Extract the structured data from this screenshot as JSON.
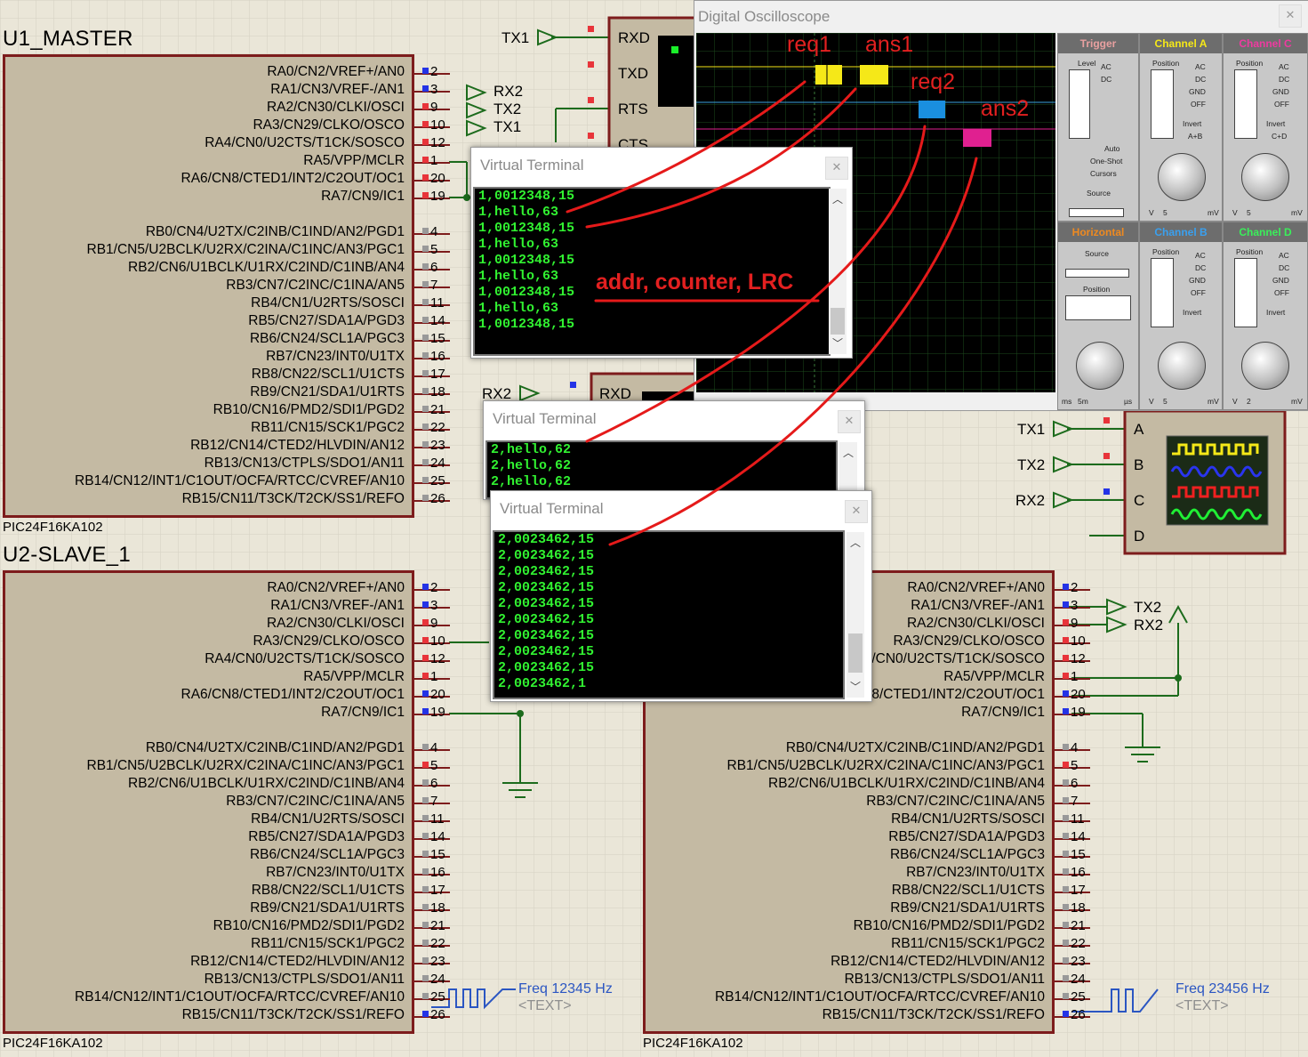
{
  "chips": {
    "master": {
      "title": "U1_MASTER",
      "part": "PIC24F16KA102"
    },
    "slave1": {
      "title": "U2-SLAVE_1",
      "part": "PIC24F16KA102"
    },
    "slave2": {
      "part": "PIC24F16KA102"
    }
  },
  "pins_ra": [
    {
      "label": "RA0/CN2/VREF+/AN0",
      "num": "2"
    },
    {
      "label": "RA1/CN3/VREF-/AN1",
      "num": "3"
    },
    {
      "label": "RA2/CN30/CLKI/OSCI",
      "num": "9"
    },
    {
      "label": "RA3/CN29/CLKO/OSCO",
      "num": "10"
    },
    {
      "label": "RA4/CN0/U2CTS/T1CK/SOSCO",
      "num": "12"
    },
    {
      "label": "RA5/VPP/MCLR",
      "num": "1"
    },
    {
      "label": "RA6/CN8/CTED1/INT2/C2OUT/OC1",
      "num": "20"
    },
    {
      "label": "RA7/CN9/IC1",
      "num": "19"
    }
  ],
  "pins_rb": [
    {
      "label": "RB0/CN4/U2TX/C2INB/C1IND/AN2/PGD1",
      "num": "4"
    },
    {
      "label": "RB1/CN5/U2BCLK/U2RX/C2INA/C1INC/AN3/PGC1",
      "num": "5"
    },
    {
      "label": "RB2/CN6/U1BCLK/U1RX/C2IND/C1INB/AN4",
      "num": "6"
    },
    {
      "label": "RB3/CN7/C2INC/C1INA/AN5",
      "num": "7"
    },
    {
      "label": "RB4/CN1/U2RTS/SOSCI",
      "num": "11"
    },
    {
      "label": "RB5/CN27/SDA1A/PGD3",
      "num": "14"
    },
    {
      "label": "RB6/CN24/SCL1A/PGC3",
      "num": "15"
    },
    {
      "label": "RB7/CN23/INT0/U1TX",
      "num": "16"
    },
    {
      "label": "RB8/CN22/SCL1/U1CTS",
      "num": "17"
    },
    {
      "label": "RB9/CN21/SDA1/U1RTS",
      "num": "18"
    },
    {
      "label": "RB10/CN16/PMD2/SDI1/PGD2",
      "num": "21"
    },
    {
      "label": "RB11/CN15/SCK1/PGC2",
      "num": "22"
    },
    {
      "label": "RB12/CN14/CTED2/HLVDIN/AN12",
      "num": "23"
    },
    {
      "label": "RB13/CN13/CTPLS/SDO1/AN11",
      "num": "24"
    },
    {
      "label": "RB14/CN12/INT1/C1OUT/OCFA/RTCC/CVREF/AN10",
      "num": "25"
    },
    {
      "label": "RB15/CN11/T3CK/T2CK/SS1/REFO",
      "num": "26"
    }
  ],
  "terminal_pins": {
    "rxd": "RXD",
    "txd": "TXD",
    "rts": "RTS",
    "cts": "CTS"
  },
  "net_labels": {
    "tx1": "TX1",
    "tx2": "TX2",
    "rx2": "RX2"
  },
  "logic_analyzer": {
    "a": "A",
    "b": "B",
    "c": "C",
    "d": "D"
  },
  "oscilloscope": {
    "title": "Digital Oscilloscope",
    "trigger": "Trigger",
    "channel_a": "Channel A",
    "channel_b": "Channel B",
    "channel_c": "Channel C",
    "channel_d": "Channel D",
    "horizontal": "Horizontal",
    "level": "Level",
    "position": "Position",
    "source": "Source",
    "auto": "Auto",
    "one_shot": "One-Shot",
    "cursors": "Cursors",
    "ac": "AC",
    "dc": "DC",
    "gnd": "GND",
    "off": "OFF",
    "invert": "Invert",
    "a_plus_b": "A+B",
    "c_plus_d": "C+D",
    "v": "V",
    "mv": "mV",
    "ms": "ms",
    "us": "µs",
    "volt_value": "5",
    "time_value": "5m",
    "b_value": "5",
    "d_value": "2"
  },
  "terminal1": {
    "title": "Virtual Terminal",
    "lines": [
      "1,0012348,15",
      "1,hello,63",
      "1,0012348,15",
      "1,hello,63",
      "1,0012348,15",
      "1,hello,63",
      "1,0012348,15",
      "1,hello,63",
      "1,0012348,15"
    ]
  },
  "terminal2": {
    "title": "Virtual Terminal",
    "lines": [
      "2,hello,62",
      "2,hello,62",
      "2,hello,62"
    ]
  },
  "terminal3": {
    "title": "Virtual Terminal",
    "lines": [
      "2,0023462,15",
      "2,0023462,15",
      "2,0023462,15",
      "2,0023462,15",
      "2,0023462,15",
      "2,0023462,15",
      "2,0023462,15",
      "2,0023462,15",
      "2,0023462,15",
      "2,0023462,1"
    ]
  },
  "annotations": {
    "req1": "req1",
    "ans1": "ans1",
    "req2": "req2",
    "ans2": "ans2",
    "fields": "addr, counter, LRC"
  },
  "generators": {
    "slave1": {
      "freq": "Freq 12345 Hz",
      "text": "<TEXT>"
    },
    "slave2": {
      "freq": "Freq 23456 Hz",
      "text": "<TEXT>"
    }
  }
}
